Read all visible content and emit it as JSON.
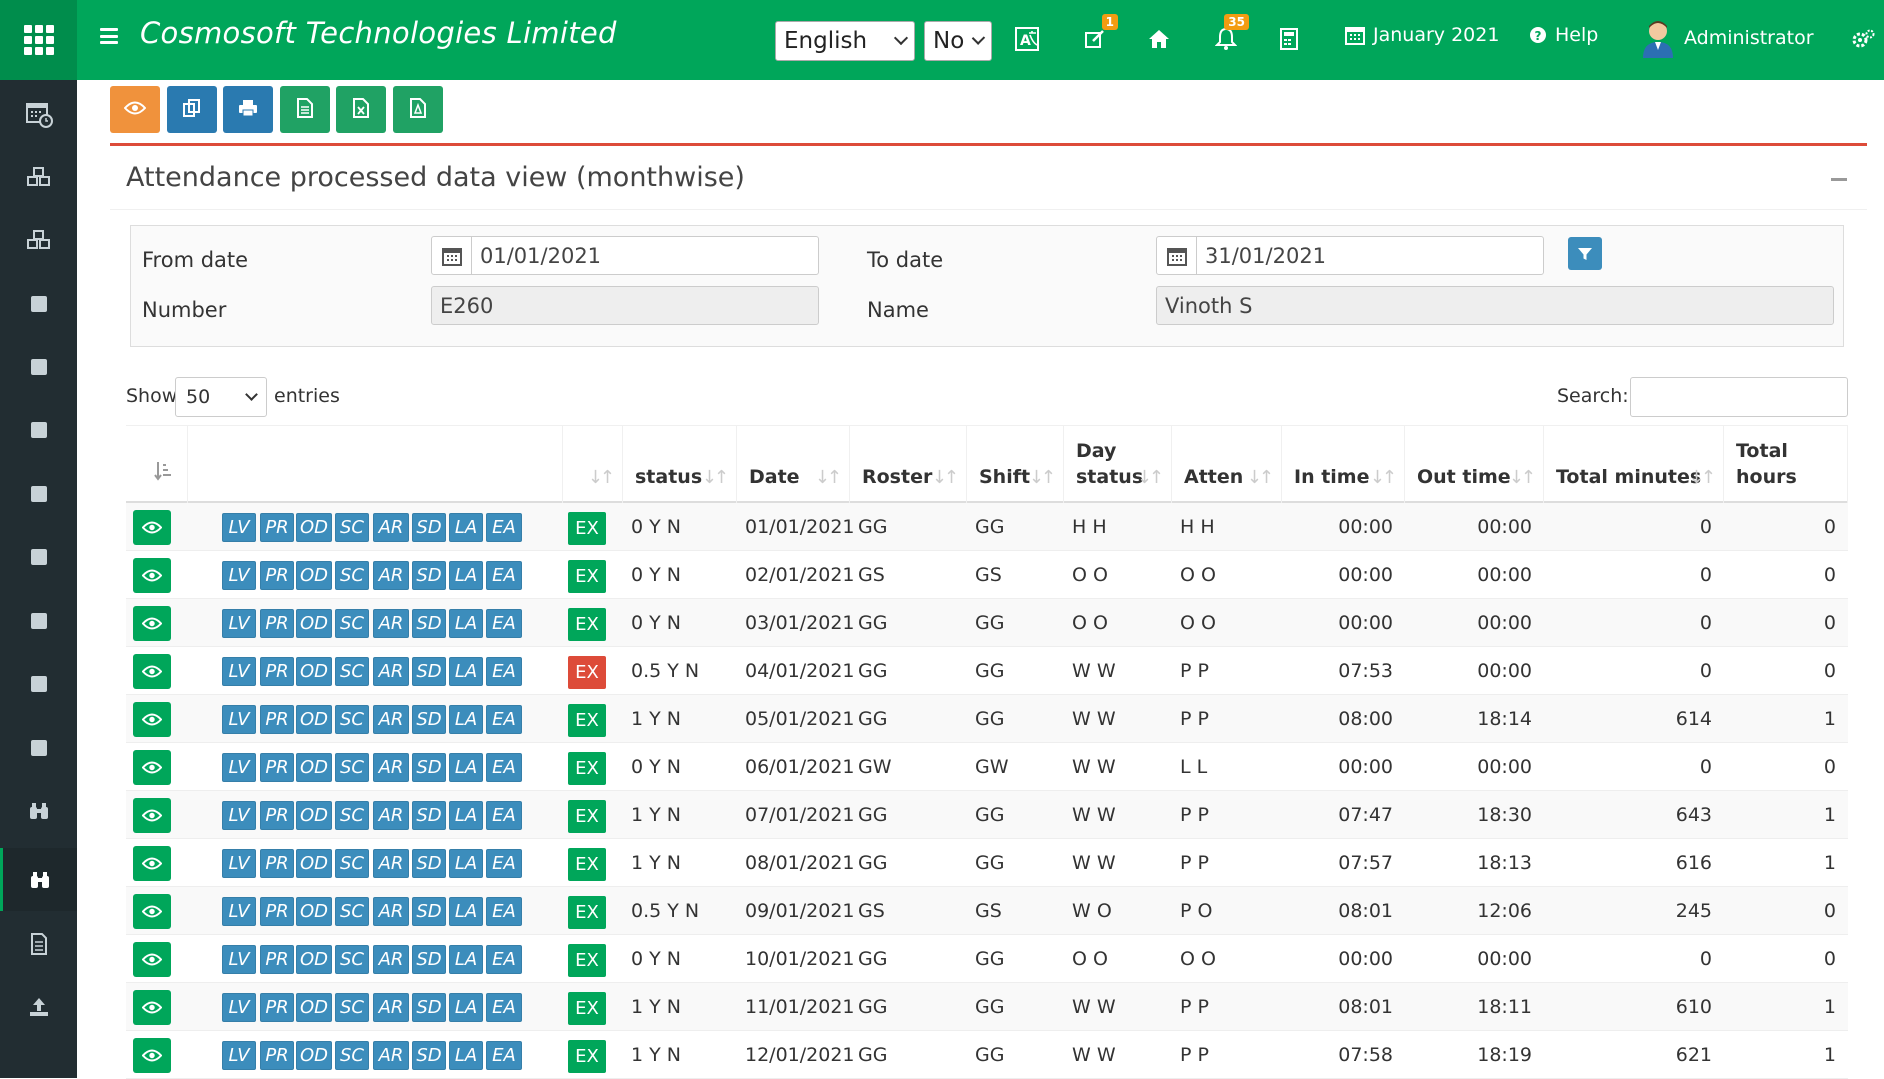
{
  "header": {
    "brand": "Cosmosoft Technologies Limited",
    "language": "English",
    "option": "No",
    "edit_badge": "1",
    "bell_badge": "35",
    "period": "January 2021",
    "help": "Help",
    "user": "Administrator"
  },
  "sidebar": {
    "icons": [
      "calendar-clock-icon",
      "cubes-icon",
      "cubes-icon",
      "square-icon",
      "square-icon",
      "square-icon",
      "square-icon",
      "square-icon",
      "square-icon",
      "square-icon",
      "square-icon",
      "binoculars-icon",
      "binoculars-icon",
      "document-icon",
      "upload-icon"
    ],
    "active_index": 12
  },
  "toolbar": {
    "buttons": [
      {
        "name": "view-button",
        "icon": "eye-icon",
        "color": "#f0923c"
      },
      {
        "name": "copy-button",
        "icon": "copy-icon",
        "color": "#2a7ab0"
      },
      {
        "name": "print-button",
        "icon": "print-icon",
        "color": "#2a7ab0"
      },
      {
        "name": "csv-button",
        "icon": "file-text-icon",
        "color": "#20a264"
      },
      {
        "name": "excel-button",
        "icon": "file-excel-icon",
        "color": "#20a264"
      },
      {
        "name": "pdf-button",
        "icon": "file-pdf-icon",
        "color": "#20a264"
      }
    ]
  },
  "box": {
    "title": "Attendance processed data view (monthwise)"
  },
  "filter": {
    "from_label": "From date",
    "from_value": "01/01/2021",
    "to_label": "To date",
    "to_value": "31/01/2021",
    "number_label": "Number",
    "number_value": "E260",
    "name_label": "Name",
    "name_value": "Vinoth S"
  },
  "table_controls": {
    "show": "Show",
    "entries_value": "50",
    "entries": "entries",
    "search": "Search:"
  },
  "table": {
    "headers": [
      "",
      "",
      "",
      "status",
      "Date",
      "Roster",
      "Shift",
      "Day status",
      "Atten",
      "In time",
      "Out time",
      "Total minutes",
      "Total hours"
    ],
    "action_buttons": [
      "LV",
      "PR",
      "OD",
      "SC",
      "AR",
      "SD",
      "LA",
      "EA"
    ],
    "ex_label": "EX",
    "ex_colors": {
      "normal": "#00a65a",
      "alert": "#dd4b39"
    },
    "rows": [
      {
        "status": "0 Y N",
        "date": "01/01/2021",
        "roster": "GG",
        "shift": "GG",
        "day": "H H",
        "atten": "H H",
        "in": "00:00",
        "out": "00:00",
        "mins": "0",
        "hours": "0",
        "ex": "normal"
      },
      {
        "status": "0 Y N",
        "date": "02/01/2021",
        "roster": "GS",
        "shift": "GS",
        "day": "O O",
        "atten": "O O",
        "in": "00:00",
        "out": "00:00",
        "mins": "0",
        "hours": "0",
        "ex": "normal"
      },
      {
        "status": "0 Y N",
        "date": "03/01/2021",
        "roster": "GG",
        "shift": "GG",
        "day": "O O",
        "atten": "O O",
        "in": "00:00",
        "out": "00:00",
        "mins": "0",
        "hours": "0",
        "ex": "normal"
      },
      {
        "status": "0.5 Y N",
        "date": "04/01/2021",
        "roster": "GG",
        "shift": "GG",
        "day": "W W",
        "atten": "P P",
        "in": "07:53",
        "out": "00:00",
        "mins": "0",
        "hours": "0",
        "ex": "alert"
      },
      {
        "status": "1 Y N",
        "date": "05/01/2021",
        "roster": "GG",
        "shift": "GG",
        "day": "W W",
        "atten": "P P",
        "in": "08:00",
        "out": "18:14",
        "mins": "614",
        "hours": "1",
        "ex": "normal"
      },
      {
        "status": "0 Y N",
        "date": "06/01/2021",
        "roster": "GW",
        "shift": "GW",
        "day": "W W",
        "atten": "L L",
        "in": "00:00",
        "out": "00:00",
        "mins": "0",
        "hours": "0",
        "ex": "normal"
      },
      {
        "status": "1 Y N",
        "date": "07/01/2021",
        "roster": "GG",
        "shift": "GG",
        "day": "W W",
        "atten": "P P",
        "in": "07:47",
        "out": "18:30",
        "mins": "643",
        "hours": "1",
        "ex": "normal"
      },
      {
        "status": "1 Y N",
        "date": "08/01/2021",
        "roster": "GG",
        "shift": "GG",
        "day": "W W",
        "atten": "P P",
        "in": "07:57",
        "out": "18:13",
        "mins": "616",
        "hours": "1",
        "ex": "normal"
      },
      {
        "status": "0.5 Y N",
        "date": "09/01/2021",
        "roster": "GS",
        "shift": "GS",
        "day": "W O",
        "atten": "P O",
        "in": "08:01",
        "out": "12:06",
        "mins": "245",
        "hours": "0",
        "ex": "normal"
      },
      {
        "status": "0 Y N",
        "date": "10/01/2021",
        "roster": "GG",
        "shift": "GG",
        "day": "O O",
        "atten": "O O",
        "in": "00:00",
        "out": "00:00",
        "mins": "0",
        "hours": "0",
        "ex": "normal"
      },
      {
        "status": "1 Y N",
        "date": "11/01/2021",
        "roster": "GG",
        "shift": "GG",
        "day": "W W",
        "atten": "P P",
        "in": "08:01",
        "out": "18:11",
        "mins": "610",
        "hours": "1",
        "ex": "normal"
      },
      {
        "status": "1 Y N",
        "date": "12/01/2021",
        "roster": "GG",
        "shift": "GG",
        "day": "W W",
        "atten": "P P",
        "in": "07:58",
        "out": "18:19",
        "mins": "621",
        "hours": "1",
        "ex": "normal"
      }
    ]
  }
}
